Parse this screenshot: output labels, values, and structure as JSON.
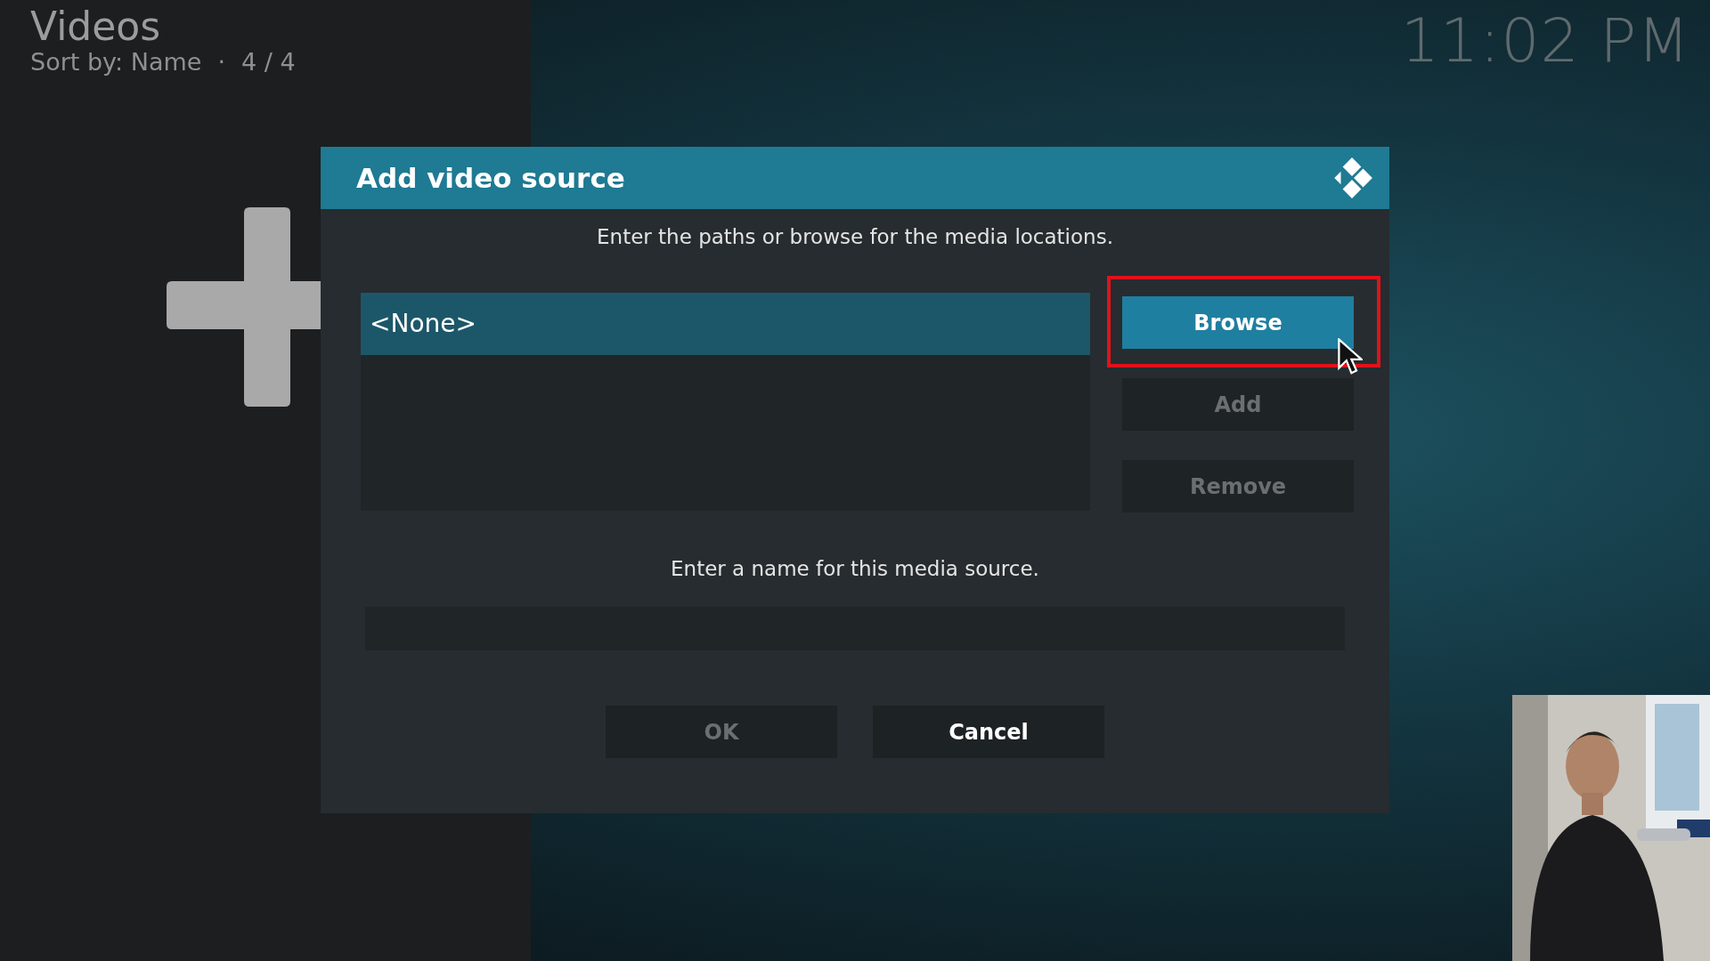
{
  "header": {
    "title": "Videos",
    "sort": "Sort by: Name",
    "separator": "·",
    "count": "4 / 4"
  },
  "clock": "11:02 PM",
  "dialog": {
    "title": "Add video source",
    "instructions": "Enter the paths or browse for the media locations.",
    "paths": [
      {
        "label": "<None>",
        "selected": true
      }
    ],
    "side_buttons": [
      {
        "label": "Browse",
        "focused": true,
        "disabled": false,
        "highlighted": true
      },
      {
        "label": "Add",
        "focused": false,
        "disabled": true,
        "highlighted": false
      },
      {
        "label": "Remove",
        "focused": false,
        "disabled": true,
        "highlighted": false
      }
    ],
    "name_prompt": "Enter a name for this media source.",
    "footer_buttons": [
      {
        "label": "OK",
        "focused": false,
        "disabled": true
      },
      {
        "label": "Cancel",
        "focused": false,
        "disabled": false
      }
    ]
  }
}
